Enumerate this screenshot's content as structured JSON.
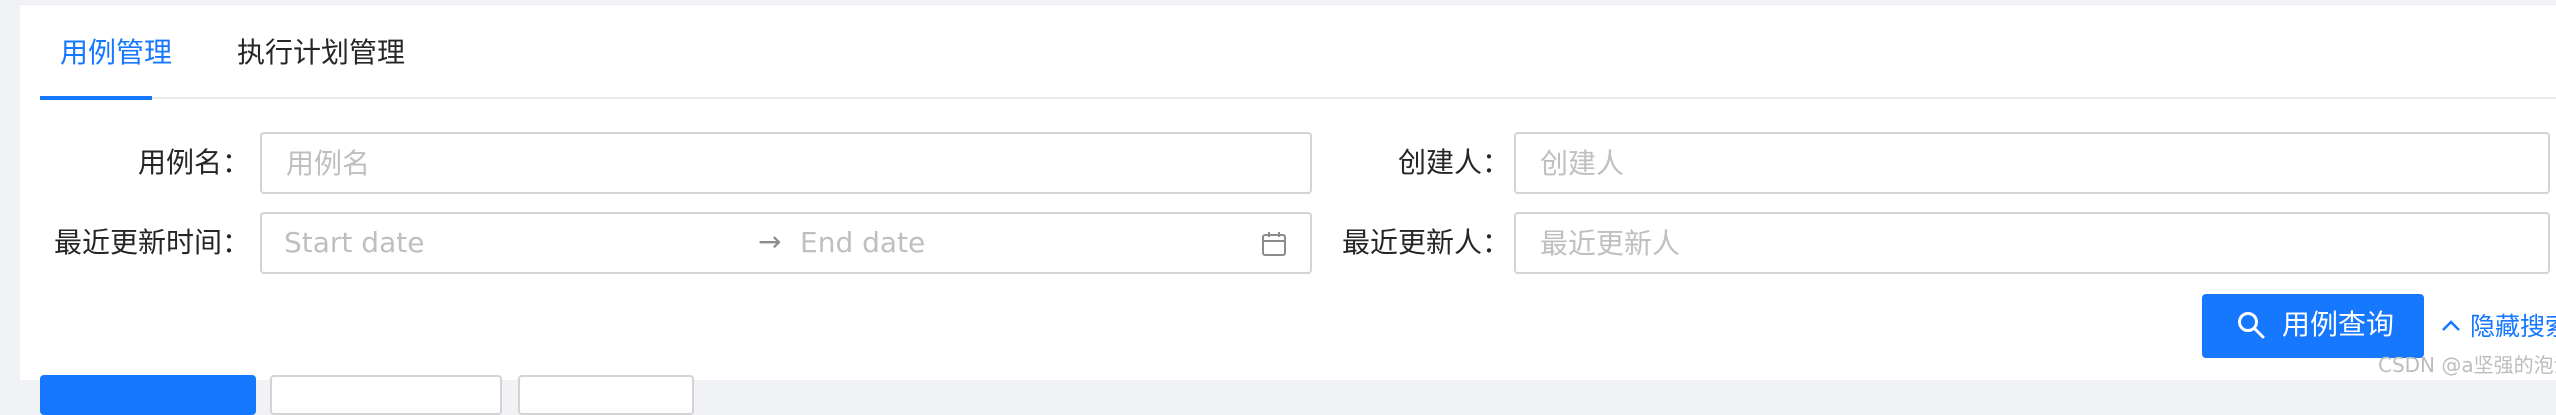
{
  "tabs": [
    {
      "label": "用例管理",
      "active": true
    },
    {
      "label": "执行计划管理",
      "active": false
    }
  ],
  "form": {
    "case_name": {
      "label": "用例名：",
      "placeholder": "用例名",
      "value": ""
    },
    "creator": {
      "label": "创建人：",
      "placeholder": "创建人",
      "value": ""
    },
    "updated_time": {
      "label": "最近更新时间：",
      "start_placeholder": "Start date",
      "separator": "→",
      "end_placeholder": "End date"
    },
    "updater": {
      "label": "最近更新人：",
      "placeholder": "最近更新人",
      "value": ""
    }
  },
  "actions": {
    "search_label": "用例查询",
    "toggle_label": "隐藏搜索"
  },
  "watermark": "CSDN @a坚强的泡沫",
  "colors": {
    "primary": "#1677ff",
    "border": "#d4d4d4",
    "placeholder": "#bfbfbf"
  }
}
